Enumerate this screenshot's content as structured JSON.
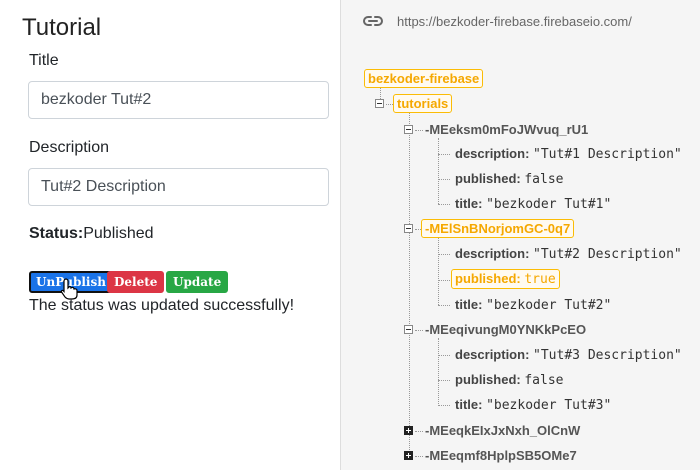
{
  "tutorial": {
    "heading": "Tutorial",
    "title_label": "Title",
    "title_value": "bezkoder Tut#2",
    "description_label": "Description",
    "description_value": "Tut#2 Description",
    "status_label": "Status:",
    "status_value": "Published",
    "buttons": {
      "unpublish": "UnPublish",
      "delete": "Delete",
      "update": "Update"
    },
    "message": "The status was updated successfully!"
  },
  "firebase": {
    "url": "https://bezkoder-firebase.firebaseio.com/",
    "root": "bezkoder-firebase",
    "collection": "tutorials",
    "items": [
      {
        "key": "-MEeksm0mFoJWvuq_rU1",
        "description_key": "description:",
        "description_value": "\"Tut#1 Description\"",
        "published_key": "published:",
        "published_value": "false",
        "title_key": "title:",
        "title_value": "\"bezkoder Tut#1\""
      },
      {
        "key": "-MElSnBNorjomGC-0q7",
        "description_key": "description:",
        "description_value": "\"Tut#2 Description\"",
        "published_key": "published:",
        "published_value": "true",
        "title_key": "title:",
        "title_value": "\"bezkoder Tut#2\""
      },
      {
        "key": "-MEeqivungM0YNKkPcEO",
        "description_key": "description:",
        "description_value": "\"Tut#3 Description\"",
        "published_key": "published:",
        "published_value": "false",
        "title_key": "title:",
        "title_value": "\"bezkoder Tut#3\""
      }
    ],
    "collapsed": [
      "-MEeqkEIxJxNxh_OlCnW",
      "-MEeqmf8HplpSB5OMe7"
    ]
  },
  "colors": {
    "highlight": "#fbbc05",
    "primary": "#1a73e8",
    "danger": "#dc3545",
    "success": "#28a745"
  },
  "icons": {
    "url": "link-icon",
    "cursor": "hand-pointer-icon"
  }
}
